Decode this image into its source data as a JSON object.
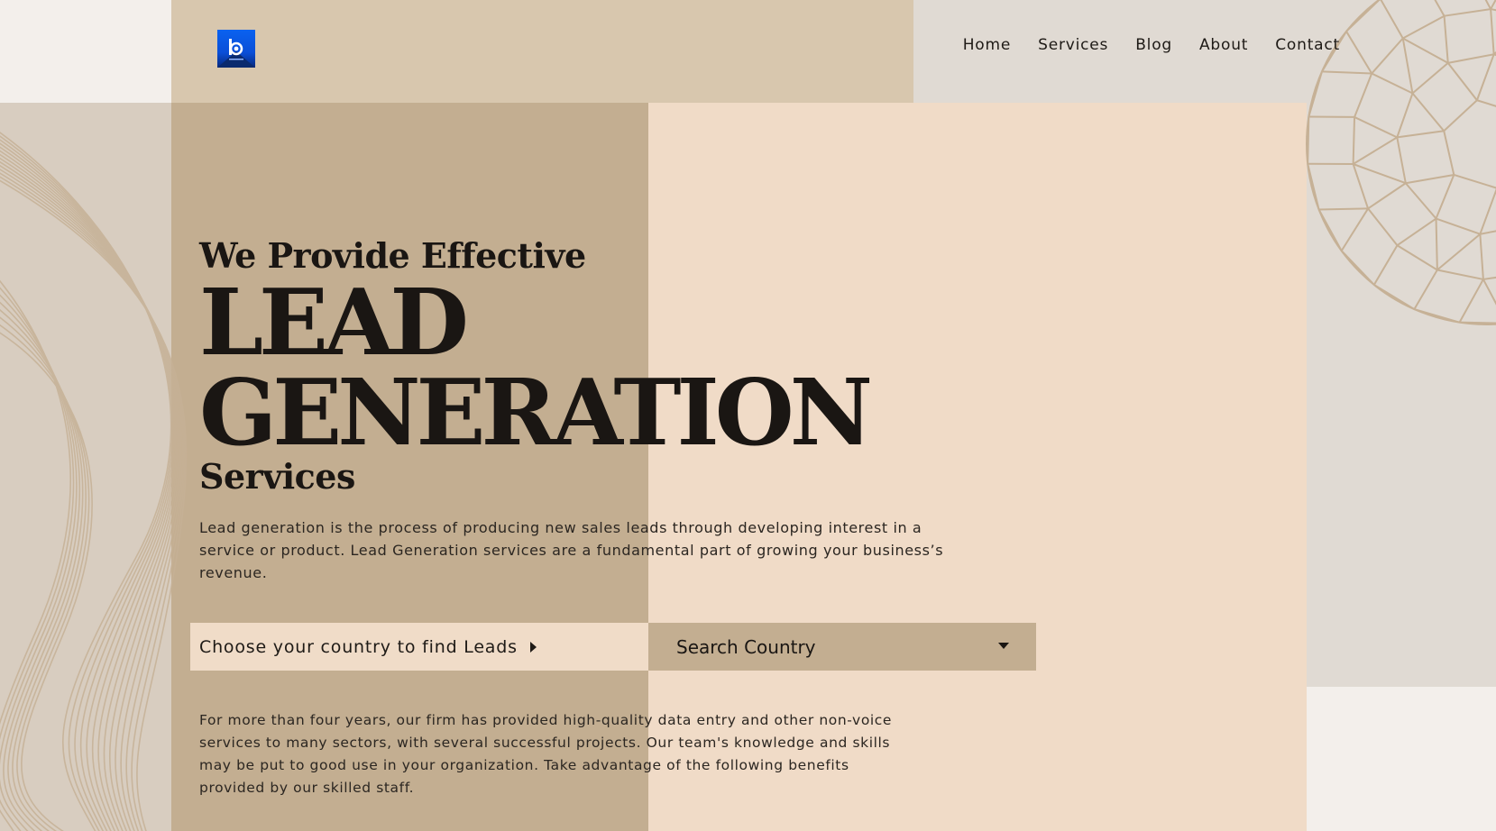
{
  "nav": {
    "items": [
      "Home",
      "Services",
      "Blog",
      "About",
      "Contact"
    ]
  },
  "hero": {
    "line1": "We Provide Effective",
    "line2": "LEAD",
    "line3": "GENERATION",
    "line4": "Services",
    "description": "Lead generation is the process of producing new sales leads through developing interest in a service or product. Lead Generation services are a fundamental part of growing your business’s revenue."
  },
  "country_finder": {
    "label": "Choose your country to find Leads",
    "select_value": "Search Country"
  },
  "about_text": "For more than four years, our firm has provided high-quality data entry and other non-voice services to many sectors, with several successful projects. Our team's knowledge and skills may be put to good use in your organization. Take advantage of the following benefits provided by our skilled staff.",
  "colors": {
    "left_panel": "#c3ae91",
    "right_panel": "#f0dbc7",
    "header_band": "#d8c7ae",
    "text": "#1a1613",
    "logo_blue": "#0a62f0"
  },
  "icons": [
    "brand-logo-icon",
    "caret-right-icon",
    "caret-down-icon"
  ]
}
